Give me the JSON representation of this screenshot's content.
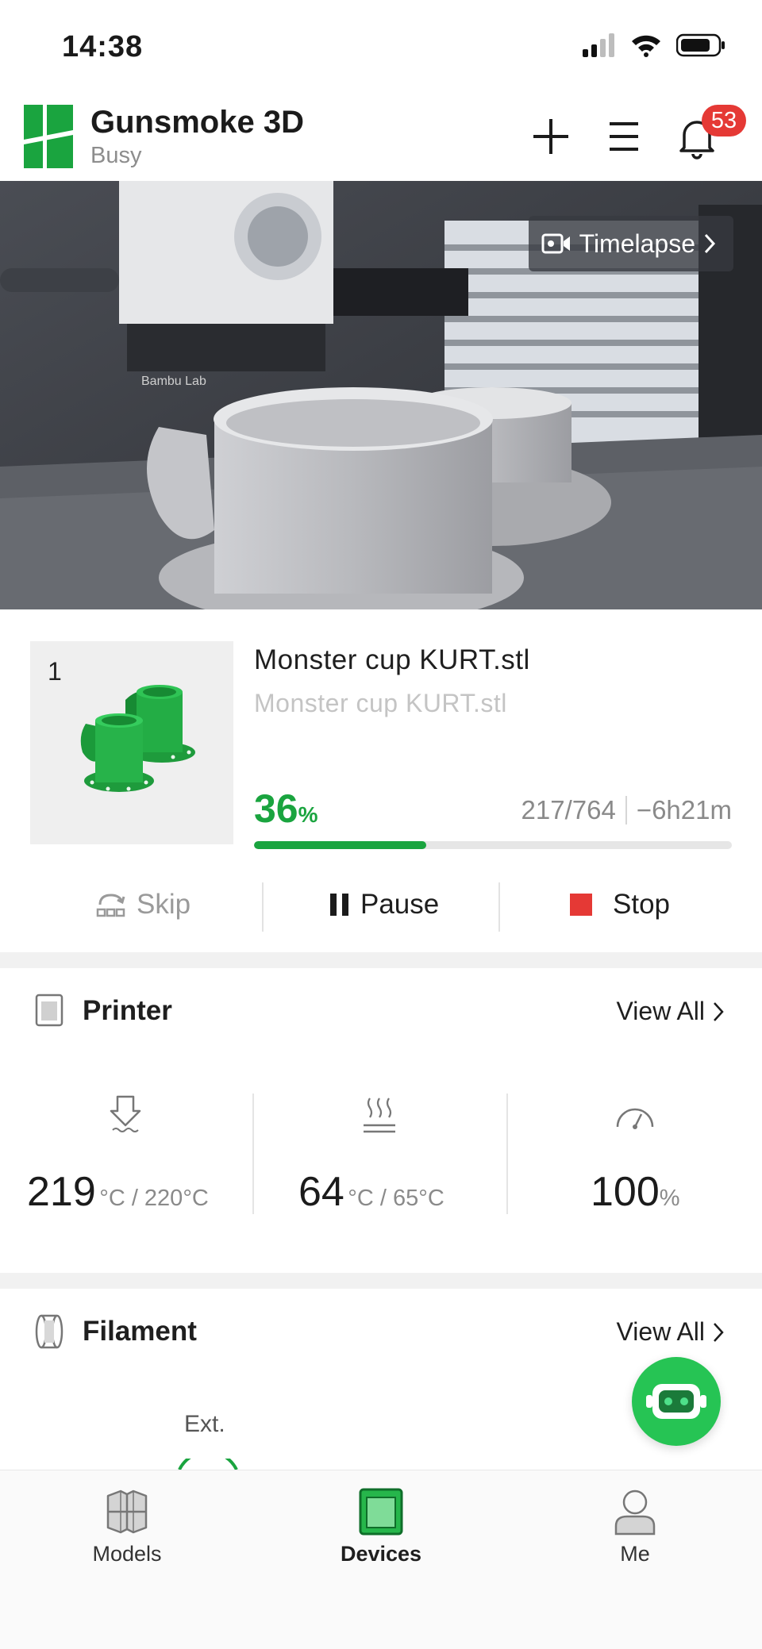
{
  "status_bar": {
    "time": "14:38"
  },
  "header": {
    "device_name": "Gunsmoke 3D",
    "device_status": "Busy",
    "notification_count": "53",
    "icons": [
      "add-icon",
      "menu-icon",
      "bell-icon"
    ]
  },
  "camera": {
    "timelapse_label": "Timelapse"
  },
  "job": {
    "plate_number": "1",
    "title": "Monster cup KURT.stl",
    "subtitle": "Monster cup KURT.stl",
    "progress_value": "36",
    "progress_sign": "%",
    "progress_fraction": 0.36,
    "layers": "217/764",
    "time_remaining": "−6h21m",
    "actions": {
      "skip": "Skip",
      "pause": "Pause",
      "stop": "Stop"
    }
  },
  "printer": {
    "title": "Printer",
    "view_all": "View All",
    "nozzle": {
      "current": "219",
      "unit": "°C / 220°C"
    },
    "bed": {
      "current": "64",
      "unit": "°C / 65°C"
    },
    "speed": {
      "current": "100",
      "unit": "%"
    }
  },
  "filament": {
    "title": "Filament",
    "view_all": "View All",
    "ext_label": "Ext."
  },
  "nav": {
    "models": "Models",
    "devices": "Devices",
    "me": "Me"
  },
  "colors": {
    "brand_green": "#1aa43f",
    "stop_red": "#e53935",
    "badge_red": "#e53935"
  }
}
